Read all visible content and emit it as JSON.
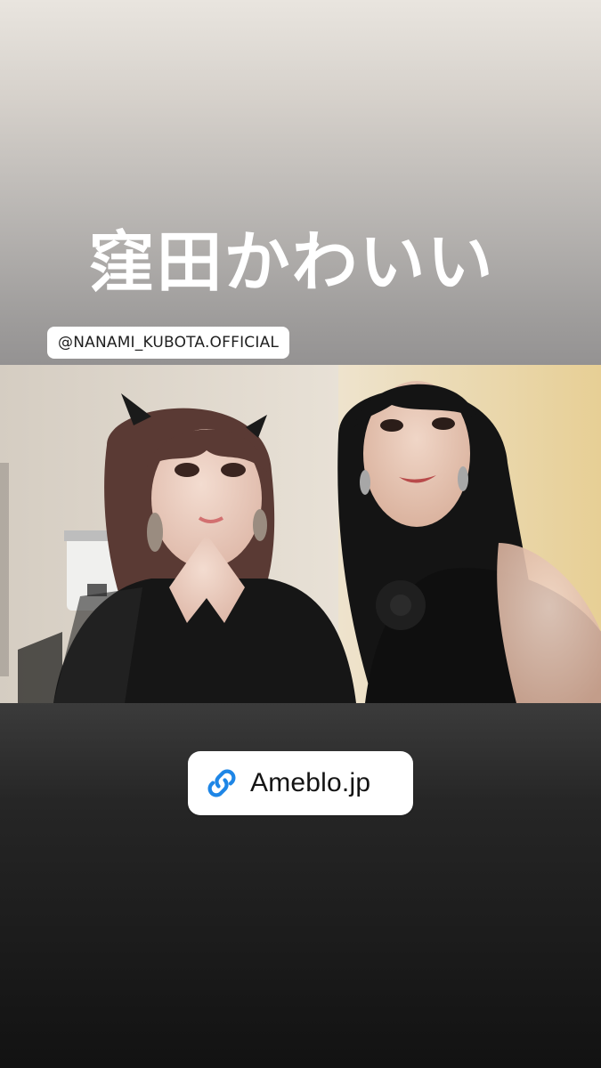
{
  "story": {
    "caption": "窪田かわいい",
    "mention": "@NANAMI_KUBOTA.OFFICIAL",
    "link": {
      "label": "Ameblo.jp",
      "icon": "link-icon"
    },
    "photo": {
      "alt": "Two women posing backstage"
    }
  }
}
